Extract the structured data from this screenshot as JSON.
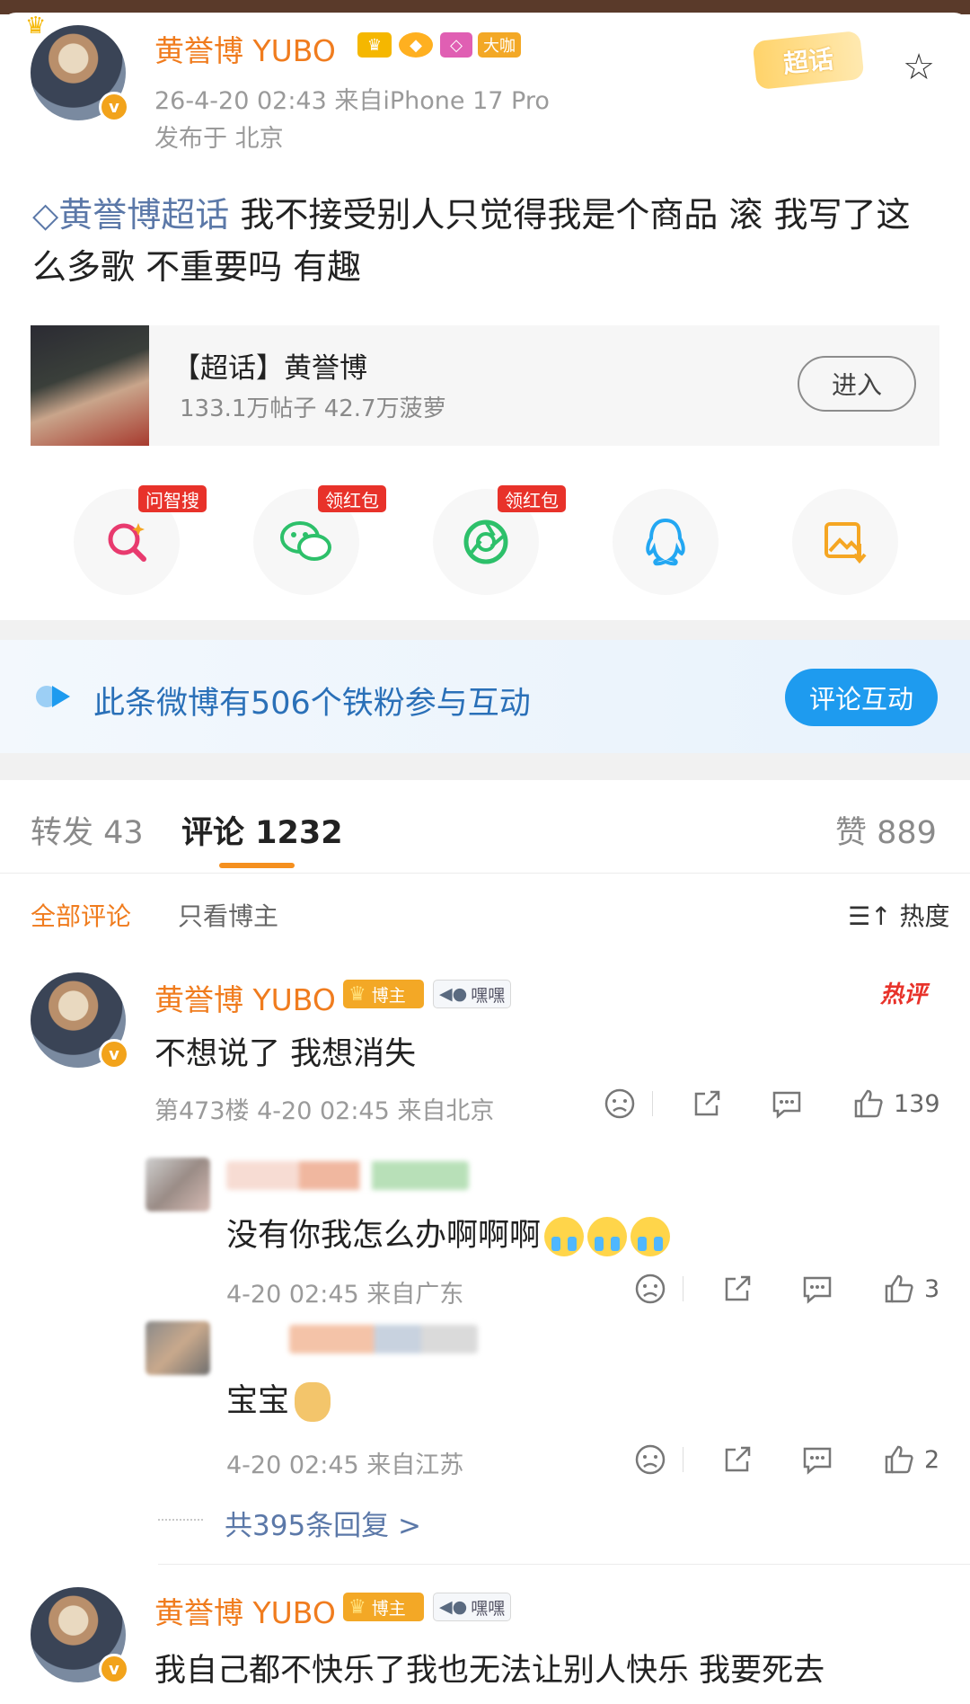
{
  "post": {
    "author": "黄誉博 YUBO",
    "vip_badge": "大咖",
    "time_source": "26-4-20 02:43  来自iPhone 17 Pro",
    "location": "发布于 北京",
    "chaohua_tag": "超话",
    "topic": "黄誉博超话",
    "text": " 我不接受别人只觉得我是个商品 滚 我写了这么多歌 不重要吗 有趣"
  },
  "supertopic": {
    "title": "【超话】黄誉博",
    "stats": "133.1万帖子 42.7万菠萝",
    "enter_label": "进入"
  },
  "share": {
    "tags": [
      "问智搜",
      "领红包",
      "领红包"
    ],
    "icons": [
      "search-ai-icon",
      "wechat-icon",
      "moments-icon",
      "qq-icon",
      "save-image-icon"
    ]
  },
  "fans": {
    "text": "此条微博有506个铁粉参与互动",
    "button": "评论互动"
  },
  "tabs": {
    "repost": "转发 43",
    "comment": "评论 1232",
    "like": "赞 889"
  },
  "filters": {
    "all": "全部评论",
    "author_only": "只看博主",
    "sort": "热度"
  },
  "comments": [
    {
      "author": "黄誉博 YUBO",
      "bozhu": "博主",
      "tag": "嘿嘿",
      "hot": "热评",
      "text": "不想说了 我想消失",
      "meta": "第473楼 4-20 02:45 来自北京",
      "likes": "139"
    },
    {
      "author": "黄誉博 YUBO",
      "bozhu": "博主",
      "tag": "嘿嘿",
      "text": "我自己都不快乐了我也无法让别人快乐 我要死去"
    }
  ],
  "replies": [
    {
      "text": "没有你我怎么办啊啊啊",
      "meta": "4-20 02:45  来自广东",
      "likes": "3"
    },
    {
      "text": "宝宝",
      "meta": "4-20 02:45  来自江苏",
      "likes": "2"
    }
  ],
  "more_replies": "共395条回复 >",
  "colors": {
    "username": "#f07c1e",
    "topic_link": "#5b78a8",
    "accent_blue": "#1e9bef",
    "tab_underline": "#f5901f",
    "hot_red": "#e8322a"
  }
}
